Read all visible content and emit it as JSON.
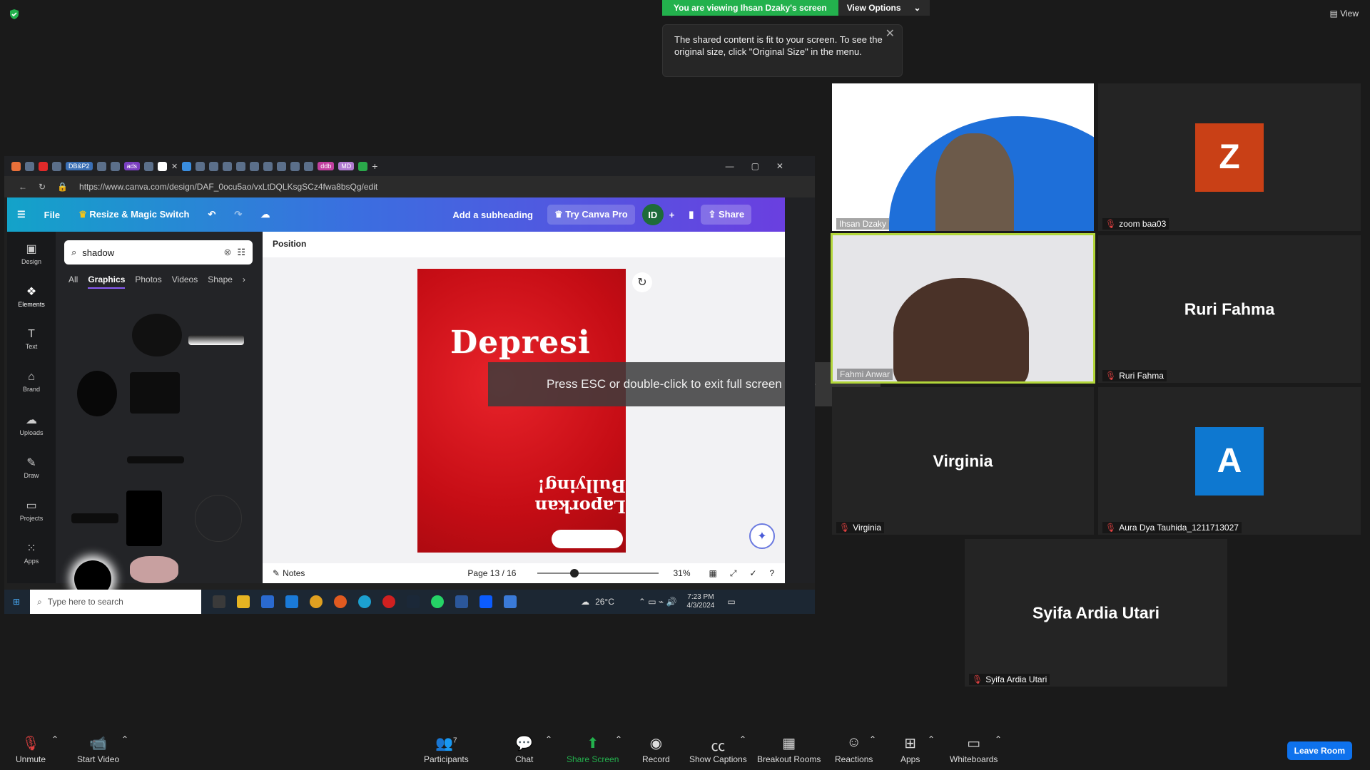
{
  "zoom": {
    "banner_text": "You are viewing Ihsan Dzaky's screen",
    "view_options_label": "View Options",
    "view_label": "View",
    "tooltip_text": "The shared content is fit to your screen. To see the original size, click \"Original Size\" in the menu.",
    "fullscreen_msg": "Press ESC or double-click to exit full screen mode",
    "leave_label": "Leave Room",
    "participants_count": "7",
    "bottom": {
      "unmute": "Unmute",
      "start_video": "Start Video",
      "participants": "Participants",
      "chat": "Chat",
      "share_screen": "Share Screen",
      "record": "Record",
      "show_captions": "Show Captions",
      "breakout_rooms": "Breakout Rooms",
      "reactions": "Reactions",
      "apps": "Apps",
      "whiteboards": "Whiteboards"
    }
  },
  "tiles": [
    {
      "name": "Ihsan Dzaky"
    },
    {
      "name": "zoom baa03",
      "initial": "Z",
      "color": "#c94016"
    },
    {
      "name": "Fahmi Anwar"
    },
    {
      "name": "Ruri Fahma",
      "display": "Ruri Fahma"
    },
    {
      "name": "Virginia",
      "display": "Virginia"
    },
    {
      "name": "Aura Dya Tauhida_1211713027",
      "initial": "A",
      "color": "#0e78d0"
    },
    {
      "name": "Syifa Ardia Utari",
      "display": "Syifa Ardia Utari"
    }
  ],
  "browser": {
    "url": "https://www.canva.com/design/DAF_0ocu5ao/vxLtDQLKsgSCz4fwa8bsQg/edit",
    "tab_ads": "ads",
    "tab_db": "DB&P2",
    "tab_ddb": "ddb",
    "tab_md": "MD"
  },
  "canva": {
    "file": "File",
    "resize": "Resize & Magic Switch",
    "add_subheading": "Add a subheading",
    "try_pro": "Try Canva Pro",
    "avatar": "ID",
    "share": "Share",
    "position": "Position",
    "search_value": "shadow",
    "categories": [
      "All",
      "Graphics",
      "Photos",
      "Videos",
      "Shape"
    ],
    "sidebar": [
      "Design",
      "Elements",
      "Text",
      "Brand",
      "Uploads",
      "Draw",
      "Projects",
      "Apps"
    ],
    "poster_title": "Depresi",
    "poster_sub": "Laporkan Bullying!",
    "notes": "Notes",
    "page": "Page 13 / 16",
    "zoom": "31%"
  },
  "taskbar": {
    "search_placeholder": "Type here to search",
    "temp": "26°C",
    "time": "7:23 PM",
    "date": "4/3/2024"
  }
}
